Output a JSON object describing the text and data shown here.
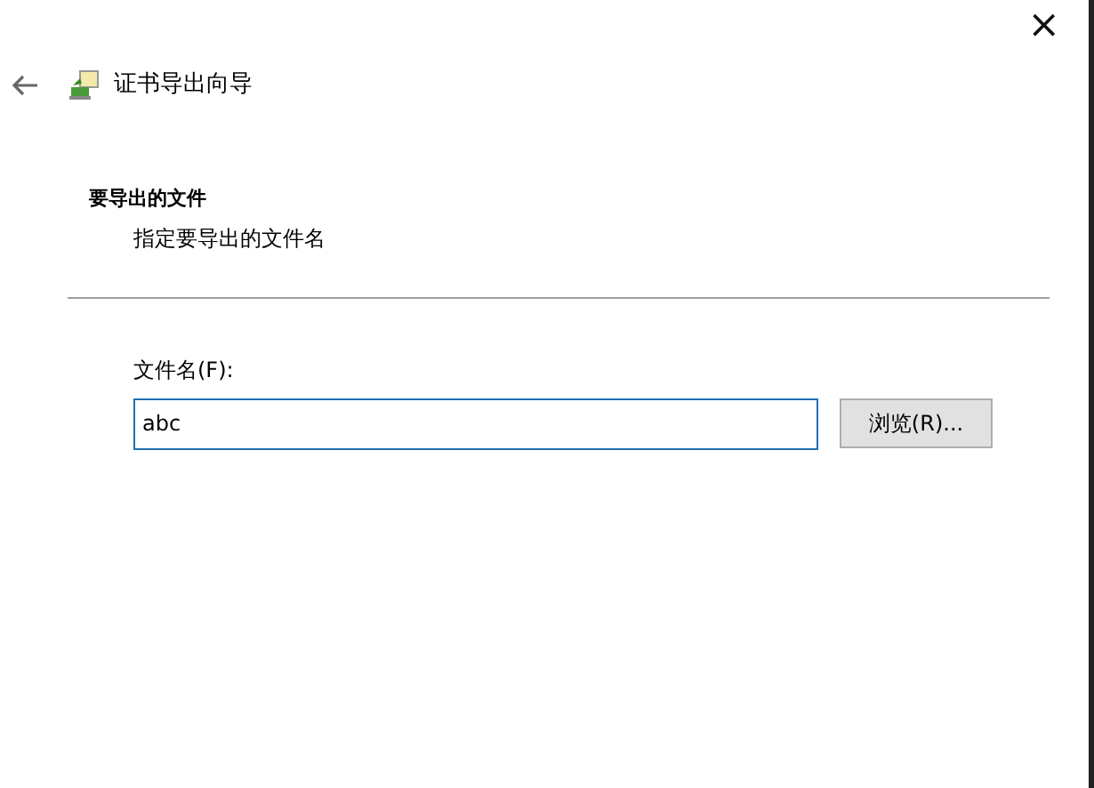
{
  "window": {
    "title": "证书导出向导",
    "close": "×"
  },
  "header": {
    "heading": "要导出的文件",
    "subtitle": "指定要导出的文件名"
  },
  "form": {
    "label": "文件名(F):",
    "value": "abc",
    "focused": true,
    "browse_button": "浏览(R)..."
  }
}
